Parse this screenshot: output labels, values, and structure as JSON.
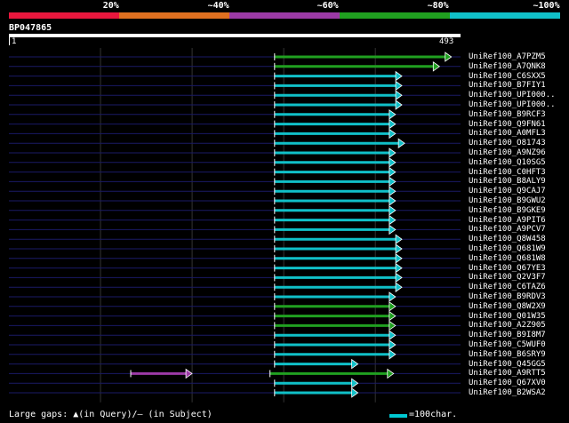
{
  "colors": {
    "background": "#000000",
    "pct_20": "#e8173d",
    "pct_40": "#e07020",
    "pct_60": "#9c3aa6",
    "pct_80": "#20a020",
    "pct_100": "#10c0c8",
    "grid": "#333333",
    "row_line": "#1a1a66"
  },
  "legend": [
    {
      "label": "20%",
      "color": "#e8173d"
    },
    {
      "label": "~40%",
      "color": "#e07020"
    },
    {
      "label": "~60%",
      "color": "#9c3aa6"
    },
    {
      "label": "~80%",
      "color": "#20a020"
    },
    {
      "label": "~100%",
      "color": "#10c0c8"
    }
  ],
  "query": {
    "name": "BP047865",
    "start": "1",
    "end": "493"
  },
  "footer": {
    "gaps_text": "Large gaps: ▲(in Query)/— (in Subject)",
    "scale_label": "=100char."
  },
  "chart_data": {
    "type": "alignment-overview",
    "query_length": 493,
    "hits": [
      {
        "name": "UniRef100_A7PZM5",
        "segments": [
          {
            "start": 290,
            "end": 483,
            "identity": "~80%"
          }
        ]
      },
      {
        "name": "UniRef100_A7QNK8",
        "segments": [
          {
            "start": 290,
            "end": 470,
            "identity": "~80%"
          }
        ]
      },
      {
        "name": "UniRef100_C6SXX5",
        "segments": [
          {
            "start": 290,
            "end": 429,
            "identity": "~100%"
          }
        ]
      },
      {
        "name": "UniRef100_B7FIY1",
        "segments": [
          {
            "start": 290,
            "end": 429,
            "identity": "~100%"
          }
        ]
      },
      {
        "name": "UniRef100_UPI000..",
        "segments": [
          {
            "start": 290,
            "end": 429,
            "identity": "~100%"
          }
        ]
      },
      {
        "name": "UniRef100_UPI000..",
        "segments": [
          {
            "start": 290,
            "end": 429,
            "identity": "~100%"
          }
        ]
      },
      {
        "name": "UniRef100_B9RCF3",
        "segments": [
          {
            "start": 290,
            "end": 422,
            "identity": "~100%"
          }
        ]
      },
      {
        "name": "UniRef100_Q9FN61",
        "segments": [
          {
            "start": 290,
            "end": 422,
            "identity": "~100%"
          }
        ]
      },
      {
        "name": "UniRef100_A0MFL3",
        "segments": [
          {
            "start": 290,
            "end": 422,
            "identity": "~100%"
          }
        ]
      },
      {
        "name": "UniRef100_O81743",
        "segments": [
          {
            "start": 290,
            "end": 432,
            "identity": "~100%"
          }
        ]
      },
      {
        "name": "UniRef100_A9NZ96",
        "segments": [
          {
            "start": 290,
            "end": 422,
            "identity": "~100%"
          }
        ]
      },
      {
        "name": "UniRef100_Q10SG5",
        "segments": [
          {
            "start": 290,
            "end": 422,
            "identity": "~100%"
          }
        ]
      },
      {
        "name": "UniRef100_C0HFT3",
        "segments": [
          {
            "start": 290,
            "end": 422,
            "identity": "~100%"
          }
        ]
      },
      {
        "name": "UniRef100_B8ALY9",
        "segments": [
          {
            "start": 290,
            "end": 422,
            "identity": "~100%"
          }
        ]
      },
      {
        "name": "UniRef100_Q9CAJ7",
        "segments": [
          {
            "start": 290,
            "end": 422,
            "identity": "~100%"
          }
        ]
      },
      {
        "name": "UniRef100_B9GWU2",
        "segments": [
          {
            "start": 290,
            "end": 422,
            "identity": "~100%"
          }
        ]
      },
      {
        "name": "UniRef100_B9GKE9",
        "segments": [
          {
            "start": 290,
            "end": 422,
            "identity": "~100%"
          }
        ]
      },
      {
        "name": "UniRef100_A9PIT6",
        "segments": [
          {
            "start": 290,
            "end": 422,
            "identity": "~100%"
          }
        ]
      },
      {
        "name": "UniRef100_A9PCV7",
        "segments": [
          {
            "start": 290,
            "end": 422,
            "identity": "~100%"
          }
        ]
      },
      {
        "name": "UniRef100_Q8W458",
        "segments": [
          {
            "start": 290,
            "end": 429,
            "identity": "~100%"
          }
        ]
      },
      {
        "name": "UniRef100_Q681W9",
        "segments": [
          {
            "start": 290,
            "end": 429,
            "identity": "~100%"
          }
        ]
      },
      {
        "name": "UniRef100_Q681W8",
        "segments": [
          {
            "start": 290,
            "end": 429,
            "identity": "~100%"
          }
        ]
      },
      {
        "name": "UniRef100_Q67YE3",
        "segments": [
          {
            "start": 290,
            "end": 429,
            "identity": "~100%"
          }
        ]
      },
      {
        "name": "UniRef100_Q2V3F7",
        "segments": [
          {
            "start": 290,
            "end": 429,
            "identity": "~100%"
          }
        ]
      },
      {
        "name": "UniRef100_C6TAZ6",
        "segments": [
          {
            "start": 290,
            "end": 429,
            "identity": "~100%"
          }
        ]
      },
      {
        "name": "UniRef100_B9RDV3",
        "segments": [
          {
            "start": 290,
            "end": 422,
            "identity": "~100%"
          }
        ]
      },
      {
        "name": "UniRef100_Q8W2X9",
        "segments": [
          {
            "start": 290,
            "end": 422,
            "identity": "~80%"
          }
        ]
      },
      {
        "name": "UniRef100_Q01W35",
        "segments": [
          {
            "start": 290,
            "end": 422,
            "identity": "~80%"
          }
        ]
      },
      {
        "name": "UniRef100_A2Z905",
        "segments": [
          {
            "start": 290,
            "end": 422,
            "identity": "~80%"
          }
        ]
      },
      {
        "name": "UniRef100_B9I8M7",
        "segments": [
          {
            "start": 290,
            "end": 422,
            "identity": "~100%"
          }
        ]
      },
      {
        "name": "UniRef100_C5WUF0",
        "segments": [
          {
            "start": 290,
            "end": 422,
            "identity": "~100%"
          }
        ]
      },
      {
        "name": "UniRef100_B6SRY9",
        "segments": [
          {
            "start": 290,
            "end": 422,
            "identity": "~100%"
          }
        ]
      },
      {
        "name": "UniRef100_Q45GG5",
        "segments": [
          {
            "start": 290,
            "end": 381,
            "identity": "~100%"
          }
        ]
      },
      {
        "name": "UniRef100_A9RTT5",
        "segments": [
          {
            "start": 133,
            "end": 200,
            "identity": "~60%"
          },
          {
            "start": 285,
            "end": 420,
            "identity": "~80%"
          }
        ]
      },
      {
        "name": "UniRef100_Q67XV0",
        "segments": [
          {
            "start": 290,
            "end": 381,
            "identity": "~100%"
          }
        ]
      },
      {
        "name": "UniRef100_B2WSA2",
        "segments": [
          {
            "start": 290,
            "end": 381,
            "identity": "~100%"
          }
        ]
      }
    ]
  }
}
